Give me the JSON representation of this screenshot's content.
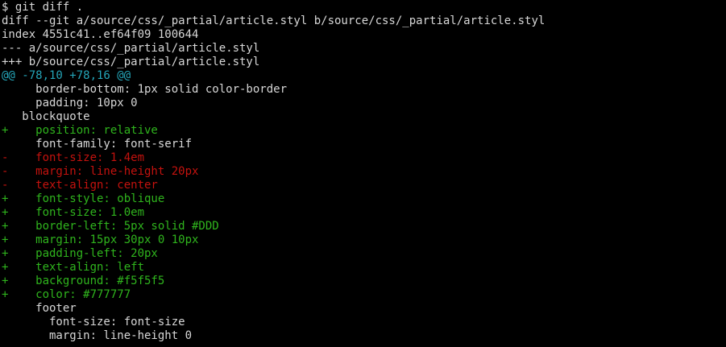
{
  "command": "$ git diff .",
  "colors": {
    "default": "#d7d7d7",
    "added": "#2fb41d",
    "removed": "#c4120e",
    "hunk": "#24a5b8",
    "background": "#000000"
  },
  "lines": [
    {
      "type": "meta",
      "text": "diff --git a/source/css/_partial/article.styl b/source/css/_partial/article.styl"
    },
    {
      "type": "meta",
      "text": "index 4551c41..ef64f09 100644"
    },
    {
      "type": "meta",
      "text": "--- a/source/css/_partial/article.styl"
    },
    {
      "type": "meta",
      "text": "+++ b/source/css/_partial/article.styl"
    },
    {
      "type": "hunk",
      "text": "@@ -78,10 +78,16 @@"
    },
    {
      "type": "context",
      "text": "     border-bottom: 1px solid color-border"
    },
    {
      "type": "context",
      "text": "     padding: 10px 0"
    },
    {
      "type": "context",
      "text": "   blockquote"
    },
    {
      "type": "added",
      "text": "+    position: relative"
    },
    {
      "type": "context",
      "text": "     font-family: font-serif"
    },
    {
      "type": "removed",
      "text": "-    font-size: 1.4em"
    },
    {
      "type": "removed",
      "text": "-    margin: line-height 20px"
    },
    {
      "type": "removed",
      "text": "-    text-align: center"
    },
    {
      "type": "added",
      "text": "+    font-style: oblique"
    },
    {
      "type": "added",
      "text": "+    font-size: 1.0em"
    },
    {
      "type": "added",
      "text": "+    border-left: 5px solid #DDD"
    },
    {
      "type": "added",
      "text": "+    margin: 15px 30px 0 10px"
    },
    {
      "type": "added",
      "text": "+    padding-left: 20px"
    },
    {
      "type": "added",
      "text": "+    text-align: left"
    },
    {
      "type": "added",
      "text": "+    background: #f5f5f5"
    },
    {
      "type": "added",
      "text": "+    color: #777777"
    },
    {
      "type": "context",
      "text": "     footer"
    },
    {
      "type": "context",
      "text": "       font-size: font-size"
    },
    {
      "type": "context",
      "text": "       margin: line-height 0"
    }
  ]
}
